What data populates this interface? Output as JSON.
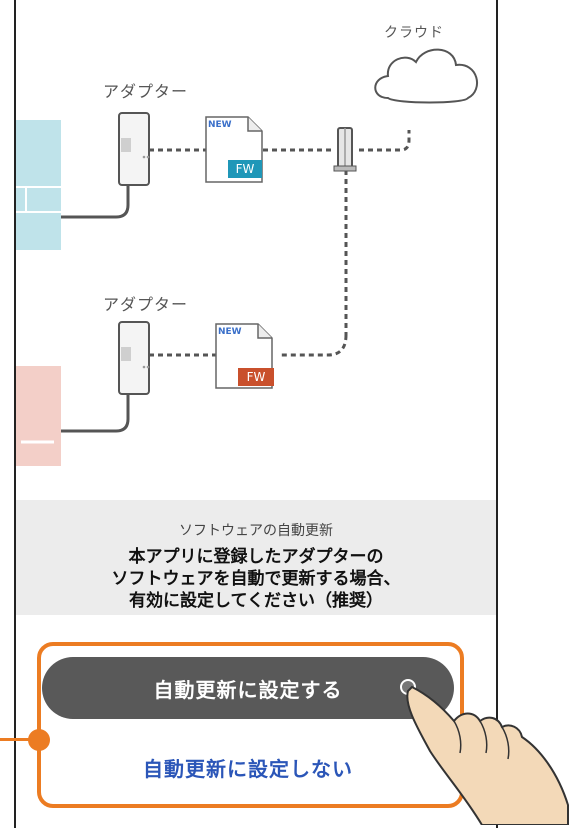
{
  "diagram": {
    "cloud_label": "クラウド",
    "adapter_label_top": "アダプター",
    "adapter_label_bottom": "アダプター",
    "file_top": {
      "badge": "NEW",
      "tag": "FW",
      "tag_color": "#1f97b8"
    },
    "file_bottom": {
      "badge": "NEW",
      "tag": "FW",
      "tag_color": "#c9502c"
    },
    "device_top_color": "#bfe3ea",
    "device_bottom_color": "#f3cfc8"
  },
  "info": {
    "title": "ソフトウェアの自動更新",
    "line1": "本アプリに登録したアダプターの",
    "line2": "ソフトウェアを自動で更新する場合、",
    "line3": "有効に設定してください（推奨）"
  },
  "buttons": {
    "enable_label": "自動更新に設定する",
    "disable_label": "自動更新に設定しない"
  },
  "colors": {
    "highlight": "#ec7c22",
    "primary_button": "#595959",
    "secondary_text": "#2b56b8"
  }
}
